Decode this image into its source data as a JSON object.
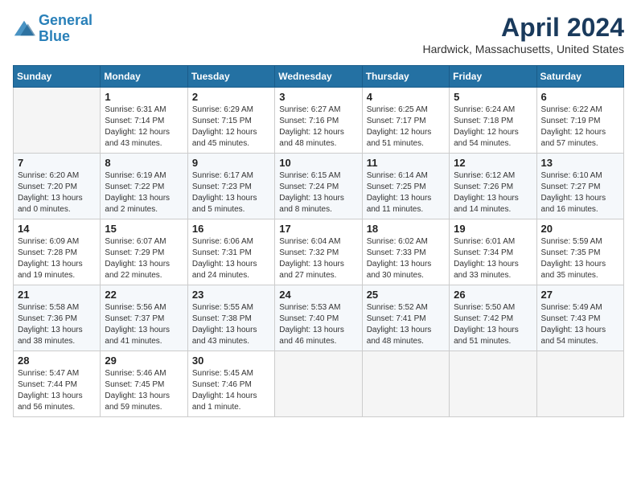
{
  "header": {
    "logo_line1": "General",
    "logo_line2": "Blue",
    "month": "April 2024",
    "location": "Hardwick, Massachusetts, United States"
  },
  "weekdays": [
    "Sunday",
    "Monday",
    "Tuesday",
    "Wednesday",
    "Thursday",
    "Friday",
    "Saturday"
  ],
  "weeks": [
    [
      {
        "num": "",
        "info": ""
      },
      {
        "num": "1",
        "info": "Sunrise: 6:31 AM\nSunset: 7:14 PM\nDaylight: 12 hours\nand 43 minutes."
      },
      {
        "num": "2",
        "info": "Sunrise: 6:29 AM\nSunset: 7:15 PM\nDaylight: 12 hours\nand 45 minutes."
      },
      {
        "num": "3",
        "info": "Sunrise: 6:27 AM\nSunset: 7:16 PM\nDaylight: 12 hours\nand 48 minutes."
      },
      {
        "num": "4",
        "info": "Sunrise: 6:25 AM\nSunset: 7:17 PM\nDaylight: 12 hours\nand 51 minutes."
      },
      {
        "num": "5",
        "info": "Sunrise: 6:24 AM\nSunset: 7:18 PM\nDaylight: 12 hours\nand 54 minutes."
      },
      {
        "num": "6",
        "info": "Sunrise: 6:22 AM\nSunset: 7:19 PM\nDaylight: 12 hours\nand 57 minutes."
      }
    ],
    [
      {
        "num": "7",
        "info": "Sunrise: 6:20 AM\nSunset: 7:20 PM\nDaylight: 13 hours\nand 0 minutes."
      },
      {
        "num": "8",
        "info": "Sunrise: 6:19 AM\nSunset: 7:22 PM\nDaylight: 13 hours\nand 2 minutes."
      },
      {
        "num": "9",
        "info": "Sunrise: 6:17 AM\nSunset: 7:23 PM\nDaylight: 13 hours\nand 5 minutes."
      },
      {
        "num": "10",
        "info": "Sunrise: 6:15 AM\nSunset: 7:24 PM\nDaylight: 13 hours\nand 8 minutes."
      },
      {
        "num": "11",
        "info": "Sunrise: 6:14 AM\nSunset: 7:25 PM\nDaylight: 13 hours\nand 11 minutes."
      },
      {
        "num": "12",
        "info": "Sunrise: 6:12 AM\nSunset: 7:26 PM\nDaylight: 13 hours\nand 14 minutes."
      },
      {
        "num": "13",
        "info": "Sunrise: 6:10 AM\nSunset: 7:27 PM\nDaylight: 13 hours\nand 16 minutes."
      }
    ],
    [
      {
        "num": "14",
        "info": "Sunrise: 6:09 AM\nSunset: 7:28 PM\nDaylight: 13 hours\nand 19 minutes."
      },
      {
        "num": "15",
        "info": "Sunrise: 6:07 AM\nSunset: 7:29 PM\nDaylight: 13 hours\nand 22 minutes."
      },
      {
        "num": "16",
        "info": "Sunrise: 6:06 AM\nSunset: 7:31 PM\nDaylight: 13 hours\nand 24 minutes."
      },
      {
        "num": "17",
        "info": "Sunrise: 6:04 AM\nSunset: 7:32 PM\nDaylight: 13 hours\nand 27 minutes."
      },
      {
        "num": "18",
        "info": "Sunrise: 6:02 AM\nSunset: 7:33 PM\nDaylight: 13 hours\nand 30 minutes."
      },
      {
        "num": "19",
        "info": "Sunrise: 6:01 AM\nSunset: 7:34 PM\nDaylight: 13 hours\nand 33 minutes."
      },
      {
        "num": "20",
        "info": "Sunrise: 5:59 AM\nSunset: 7:35 PM\nDaylight: 13 hours\nand 35 minutes."
      }
    ],
    [
      {
        "num": "21",
        "info": "Sunrise: 5:58 AM\nSunset: 7:36 PM\nDaylight: 13 hours\nand 38 minutes."
      },
      {
        "num": "22",
        "info": "Sunrise: 5:56 AM\nSunset: 7:37 PM\nDaylight: 13 hours\nand 41 minutes."
      },
      {
        "num": "23",
        "info": "Sunrise: 5:55 AM\nSunset: 7:38 PM\nDaylight: 13 hours\nand 43 minutes."
      },
      {
        "num": "24",
        "info": "Sunrise: 5:53 AM\nSunset: 7:40 PM\nDaylight: 13 hours\nand 46 minutes."
      },
      {
        "num": "25",
        "info": "Sunrise: 5:52 AM\nSunset: 7:41 PM\nDaylight: 13 hours\nand 48 minutes."
      },
      {
        "num": "26",
        "info": "Sunrise: 5:50 AM\nSunset: 7:42 PM\nDaylight: 13 hours\nand 51 minutes."
      },
      {
        "num": "27",
        "info": "Sunrise: 5:49 AM\nSunset: 7:43 PM\nDaylight: 13 hours\nand 54 minutes."
      }
    ],
    [
      {
        "num": "28",
        "info": "Sunrise: 5:47 AM\nSunset: 7:44 PM\nDaylight: 13 hours\nand 56 minutes."
      },
      {
        "num": "29",
        "info": "Sunrise: 5:46 AM\nSunset: 7:45 PM\nDaylight: 13 hours\nand 59 minutes."
      },
      {
        "num": "30",
        "info": "Sunrise: 5:45 AM\nSunset: 7:46 PM\nDaylight: 14 hours\nand 1 minute."
      },
      {
        "num": "",
        "info": ""
      },
      {
        "num": "",
        "info": ""
      },
      {
        "num": "",
        "info": ""
      },
      {
        "num": "",
        "info": ""
      }
    ]
  ]
}
